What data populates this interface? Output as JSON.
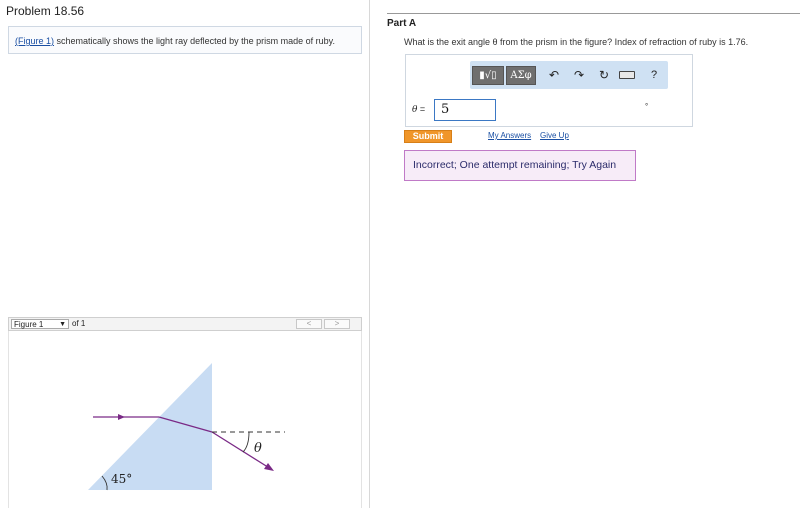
{
  "problem": {
    "title": "Problem 18.56",
    "intro_link": "(Figure 1)",
    "intro_text": " schematically shows the light ray deflected by the prism made of ruby."
  },
  "figure": {
    "select_value": "Figure 1",
    "of_label": "of 1",
    "prev_glyph": "<",
    "next_glyph": ">",
    "angle_label": "45°",
    "theta_symbol": "θ"
  },
  "part": {
    "label": "Part A",
    "question": "What is the exit angle θ from the prism in the figure? Index of refraction of ruby is 1.76."
  },
  "toolbar": {
    "frac_label": "▮√▯",
    "greek_label": "ΑΣφ",
    "undo_glyph": "↶",
    "redo_glyph": "↷",
    "reset_glyph": "↻",
    "help_glyph": "?"
  },
  "answer": {
    "variable_label": "θ",
    "equals": " = ",
    "value": "5",
    "unit": "°"
  },
  "actions": {
    "submit_label": "Submit",
    "my_answers_label": "My Answers",
    "give_up_label": "Give Up"
  },
  "feedback": {
    "message": "Incorrect; One attempt remaining; Try Again"
  },
  "colors": {
    "prism_fill": "#c8dcf3",
    "ray": "#7a2a86",
    "submit": "#f0962a",
    "feedback_border": "#c07ac7"
  }
}
